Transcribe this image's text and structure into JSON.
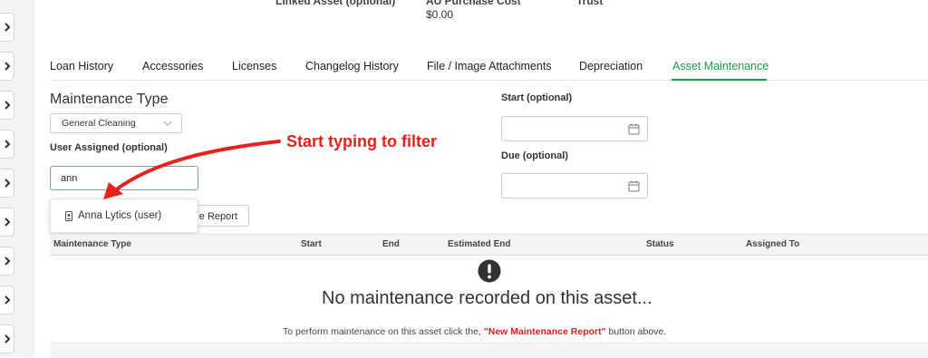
{
  "top_fields": {
    "linked_asset_label": "Linked Asset (optional)",
    "purchase_cost_label": "AU Purchase Cost",
    "purchase_cost_value": "$0.00",
    "trust_label": "Trust"
  },
  "tabs": [
    {
      "label": "Loan History",
      "active": false
    },
    {
      "label": "Accessories",
      "active": false
    },
    {
      "label": "Licenses",
      "active": false
    },
    {
      "label": "Changelog History",
      "active": false
    },
    {
      "label": "File / Image Attachments",
      "active": false
    },
    {
      "label": "Depreciation",
      "active": false
    },
    {
      "label": "Asset Maintenance",
      "active": true
    }
  ],
  "form": {
    "maintenance_type_title": "Maintenance Type",
    "maintenance_type_value": "General Cleaning",
    "user_assigned_label": "User Assigned (optional)",
    "user_assigned_value": "ann",
    "start_label": "Start (optional)",
    "due_label": "Due (optional)",
    "report_button_partial": "e Report"
  },
  "autocomplete": {
    "option_label": "Anna Lytics (user)"
  },
  "table": {
    "headers": [
      "Maintenance Type",
      "Start",
      "End",
      "Estimated End",
      "Status",
      "Assigned To"
    ]
  },
  "empty_state": {
    "title": "No maintenance recorded on this asset...",
    "subtitle_prefix": "To perform maintenance on this asset click the,",
    "subtitle_emphasis": "\"New Maintenance Report\"",
    "subtitle_suffix": "button above."
  },
  "annotation": {
    "text": "Start typing to filter"
  },
  "colors": {
    "accent": "#1c9a4c",
    "annotation": "#e8211b",
    "emphasis": "#d9211d",
    "input_focus": "#6a9fd8"
  },
  "icons": {
    "rail_buttons": "chevron-right-icon",
    "date_picker": "calendar-icon",
    "empty_state": "exclamation-circle-icon",
    "option": "user-icon"
  }
}
